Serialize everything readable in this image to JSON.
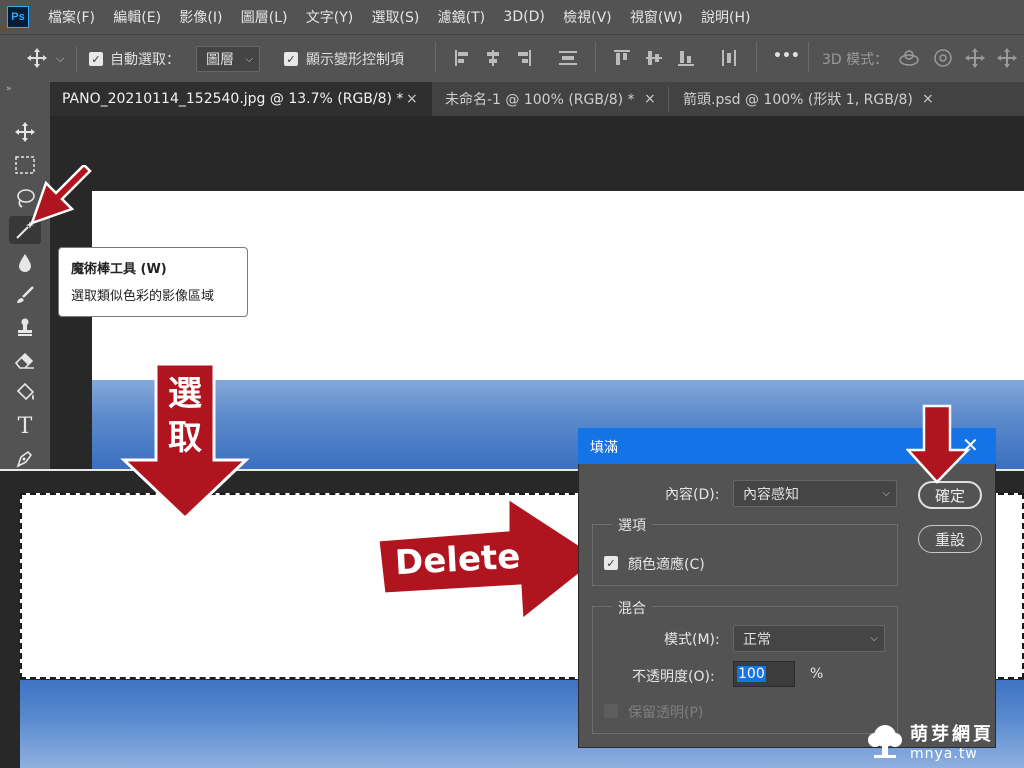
{
  "menubar": {
    "logo": "Ps",
    "items": [
      "檔案(F)",
      "編輯(E)",
      "影像(I)",
      "圖層(L)",
      "文字(Y)",
      "選取(S)",
      "濾鏡(T)",
      "3D(D)",
      "檢視(V)",
      "視窗(W)",
      "說明(H)"
    ]
  },
  "options": {
    "auto_select_label": "自動選取：",
    "auto_select_value": "圖層",
    "show_transform_label": "顯示變形控制項",
    "more": "•••",
    "mode_3d_label": "3D 模式："
  },
  "tabs": [
    {
      "label": "PANO_20210114_152540.jpg @ 13.7% (RGB/8) *",
      "close": "×"
    },
    {
      "label": "未命名-1 @ 100% (RGB/8) *",
      "close": "×"
    },
    {
      "label": "箭頭.psd @ 100% (形狀 1, RGB/8)",
      "close": "×"
    }
  ],
  "tooltip": {
    "title": "魔術棒工具 (W)",
    "description": "選取類似色彩的影像區域"
  },
  "annotations": {
    "select_label": [
      "選",
      "取"
    ],
    "delete_label": "Delete",
    "accent_color": "#b0151f"
  },
  "dialog": {
    "title": "填滿",
    "content_label": "內容(D):",
    "content_value": "內容感知",
    "options_group": "選項",
    "color_adapt_label": "顏色適應(C)",
    "blend_group": "混合",
    "mode_label": "模式(M):",
    "mode_value": "正常",
    "opacity_label": "不透明度(O):",
    "opacity_value": "100",
    "opacity_unit": "%",
    "preserve_label": "保留透明(P)",
    "ok_button": "確定",
    "reset_button": "重設",
    "title_color": "#1473e6"
  },
  "watermark": {
    "title": "萌芽網頁",
    "url": "mnya.tw"
  }
}
